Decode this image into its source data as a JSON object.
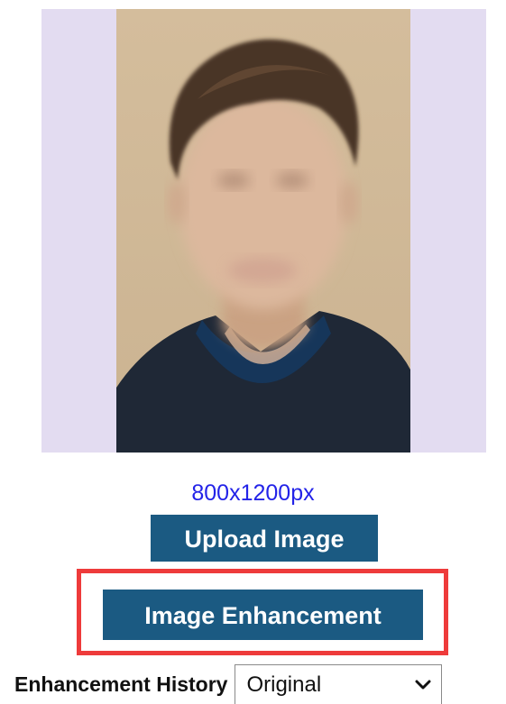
{
  "preview": {
    "size_label": "800x1200px"
  },
  "actions": {
    "upload_label": "Upload Image",
    "enhance_label": "Image Enhancement"
  },
  "history": {
    "label": "Enhancement History",
    "selected": "Original"
  },
  "icons": {
    "dropdown": "chevron-down-icon",
    "photo": "portrait-photo"
  },
  "colors": {
    "button_bg": "#1b5a82",
    "size_text": "#2323e8",
    "highlight": "#ee3b3b",
    "preview_bg": "#e3dcf1"
  }
}
